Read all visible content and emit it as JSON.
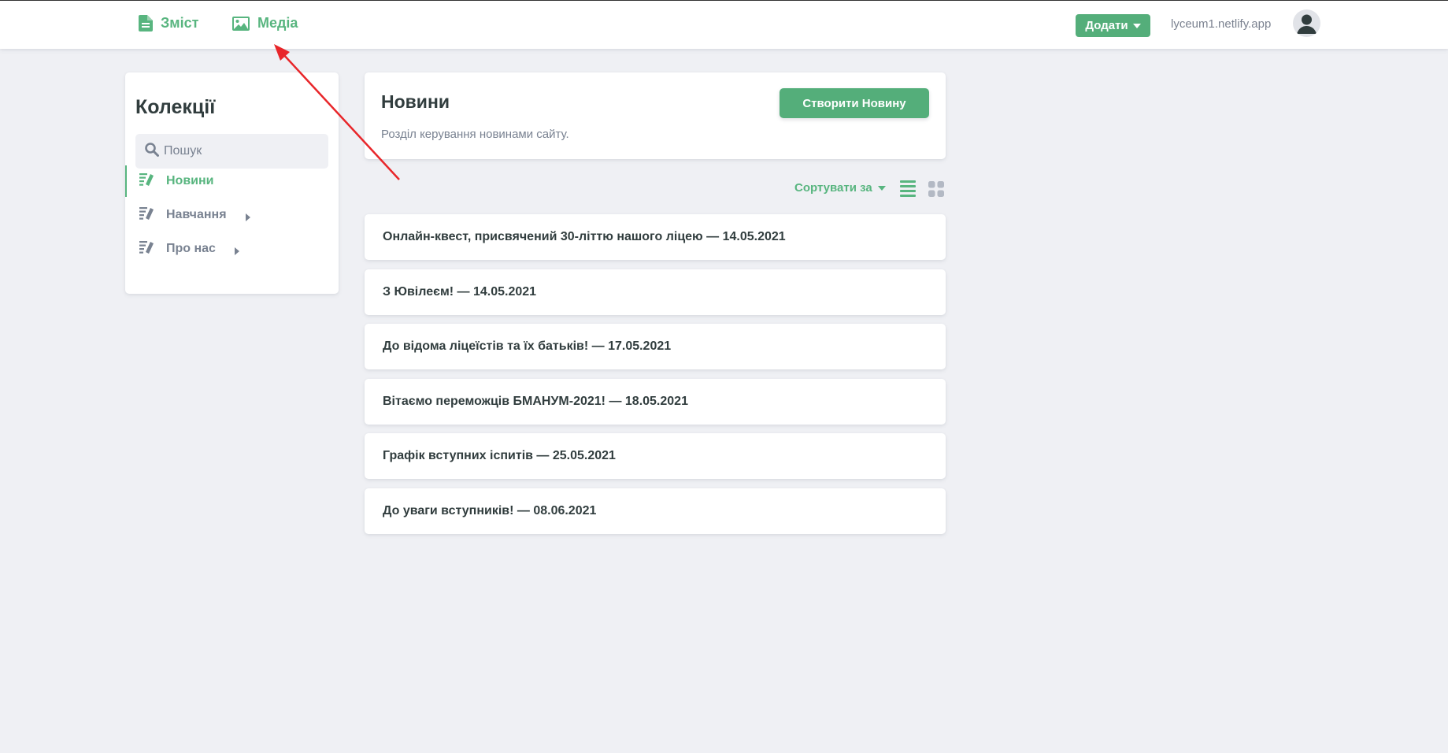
{
  "topbar": {
    "content_label": "Зміст",
    "media_label": "Медіа",
    "add_label": "Додати",
    "site_url": "lyceum1.netlify.app"
  },
  "sidebar": {
    "title": "Колекції",
    "search_placeholder": "Пошук",
    "items": [
      {
        "label": "Новини",
        "active": true
      },
      {
        "label": "Навчання",
        "has_children": true
      },
      {
        "label": "Про нас",
        "has_children": true
      }
    ]
  },
  "collection": {
    "title": "Новини",
    "description": "Розділ керування новинами сайту.",
    "create_label": "Створити Новину",
    "sort_label": "Сортувати за"
  },
  "entries": [
    "Онлайн-квест, присвячений 30-літтю нашого ліцею — 14.05.2021",
    "З Ювілеєм! — 14.05.2021",
    "До відома ліцеїстів та їх батьків! — 17.05.2021",
    "Вітаємо переможців БМАНУМ-2021! — 18.05.2021",
    "Графік вступних іспитів — 25.05.2021",
    "До уваги вступників! — 08.06.2021"
  ],
  "colors": {
    "accent": "#58b57f",
    "button": "#54ae7a",
    "background": "#eff0f4",
    "annotation_arrow": "#e8262a"
  },
  "icons": [
    "document-icon",
    "image-icon",
    "search-icon",
    "collection-icon",
    "list-view-icon",
    "grid-view-icon",
    "user-icon"
  ]
}
